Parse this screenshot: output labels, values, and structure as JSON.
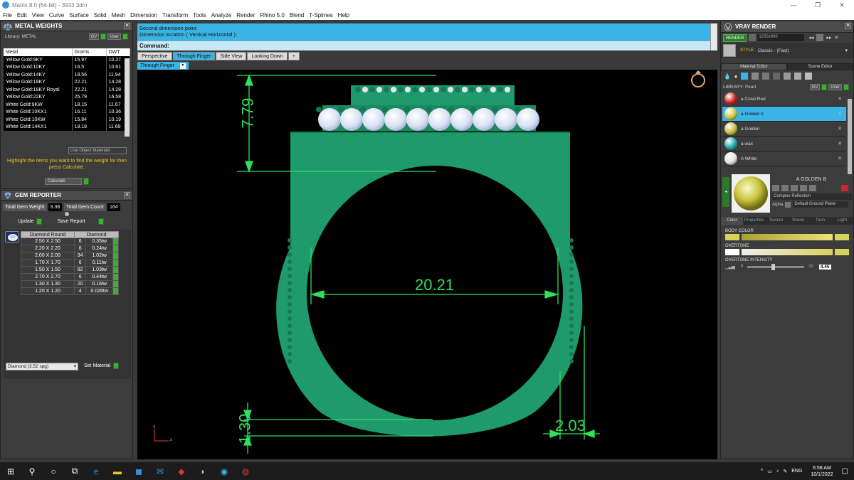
{
  "window": {
    "title": "Matrix 8.0 (64-bit) - 3933.3dm",
    "minimize": "—",
    "restore": "❐",
    "close": "✕"
  },
  "menu": [
    "File",
    "Edit",
    "View",
    "Curve",
    "Surface",
    "Solid",
    "Mesh",
    "Dimension",
    "Transform",
    "Tools",
    "Analyze",
    "Render",
    "Rhino 5.0",
    "Blend",
    "T-Splines",
    "Help"
  ],
  "metal_weights": {
    "title": "METAL WEIGHTS",
    "library_label": "Library: METAL",
    "gv_btn": "GV",
    "user_btn": "User",
    "columns": [
      "Metal",
      "Grams",
      "DWT"
    ],
    "rows": [
      [
        "Yellow Gold:9KY",
        "15.97",
        "10.27"
      ],
      [
        "Yellow Gold:10KY",
        "16.5",
        "10.61"
      ],
      [
        "Yellow Gold:14KY",
        "18.56",
        "11.94"
      ],
      [
        "Yellow Gold:18KY",
        "22.21",
        "14.28"
      ],
      [
        "Yellow Gold:18KY Royal",
        "22.21",
        "14.28"
      ],
      [
        "Yellow Gold:22KY",
        "25.79",
        "16.58"
      ],
      [
        "White Gold:9KW",
        "18.15",
        "11.67"
      ],
      [
        "White Gold:10KX1",
        "16.11",
        "10.36"
      ],
      [
        "White Gold:10KW",
        "15.84",
        "10.19"
      ],
      [
        "White Gold:14KX1",
        "18.18",
        "11.69"
      ]
    ],
    "use_object_materials": "Use Object Materials",
    "hint": "Highlight the items you want to find the weight for then press Calculate.",
    "calculate": "Calculate"
  },
  "gem_reporter": {
    "title": "GEM REPORTER",
    "total_weight_label": "Total Gem Weight",
    "total_weight": "3.38",
    "total_count_label": "Total Gem Count",
    "total_count": "164",
    "update": "Update",
    "save_report": "Save Report",
    "columns": [
      "Diamond Round",
      "Diamond"
    ],
    "rows": [
      [
        "2.50 X 2.50",
        "6",
        "0.35tw"
      ],
      [
        "2.20 X 2.20",
        "6",
        "0.24tw"
      ],
      [
        "2.00 X 2.00",
        "34",
        "1.02tw"
      ],
      [
        "1.70 X 1.70",
        "6",
        "0.11tw"
      ],
      [
        "1.50 X 1.50",
        "82",
        "1.03tw"
      ],
      [
        "2.70 X 2.70",
        "6",
        "0.44tw"
      ],
      [
        "1.30 X 1.30",
        "20",
        "0.16tw"
      ],
      [
        "1.20 X 1.20",
        "4",
        "0.026tw"
      ]
    ],
    "material_select": "Diamond    (3.52 spg)",
    "set_material": "Set Material"
  },
  "command": {
    "line1": "Second dimension point",
    "line2": "Dimension location ( Vertical  Horizontal ):",
    "prompt": "Command:"
  },
  "view_tabs": [
    "Perspective",
    "Through Finger",
    "Side View",
    "Looking Down",
    "+"
  ],
  "active_view": "Through Finger",
  "viewport": {
    "dim_top_height": "7.79",
    "dim_inner_diameter": "20.21",
    "dim_bottom_thickness": "1.30",
    "dim_shank_width": "2.03",
    "axis_z": "z",
    "axis_x": "x",
    "colors": {
      "metal": "#1f9a6c",
      "dim": "#2ee05a",
      "gem": "#dfe6f5"
    }
  },
  "vray": {
    "title": "VRAY RENDER",
    "render_btn": "RENDER",
    "resolution": "1200x900",
    "style_label": "STYLE:",
    "style_value": "Classic - (Fast)",
    "tab_material": "Material Editor",
    "tab_scene": "Scene Editor",
    "library_label": "LIBRARY: Pearl",
    "gv_btn": "GV",
    "user_btn": "User",
    "materials": [
      {
        "name": "a Coral Red",
        "color": "#c41a1a"
      },
      {
        "name": "a Golden b",
        "color": "#c9c43a"
      },
      {
        "name": "a Golden",
        "color": "#c9b83a"
      },
      {
        "name": "a wax",
        "color": "#1aa6a6"
      },
      {
        "name": "A White",
        "color": "#e0e0e0"
      }
    ],
    "selected_material": "A GOLDEN B",
    "shader": "Complex Reflection",
    "alpha_label": "Alpha",
    "ground": "Default Ground Plane",
    "prop_tabs": [
      "Color",
      "Properties",
      "Texture",
      "Scene",
      "Toon",
      "Light"
    ],
    "body_color_label": "BODY COLOR",
    "overtone_label": "OVERTONE",
    "overtone_intensity_label": "OVERTONE INTENSITY",
    "intensity_min": "0",
    "intensity_max": "10",
    "intensity_value": "4.45",
    "intensity_fraction": 0.445,
    "body_color_hex": "#d9d25a"
  },
  "taskbar": {
    "lang": "ENG",
    "time": "6:58 AM",
    "date": "10/1/2022"
  }
}
